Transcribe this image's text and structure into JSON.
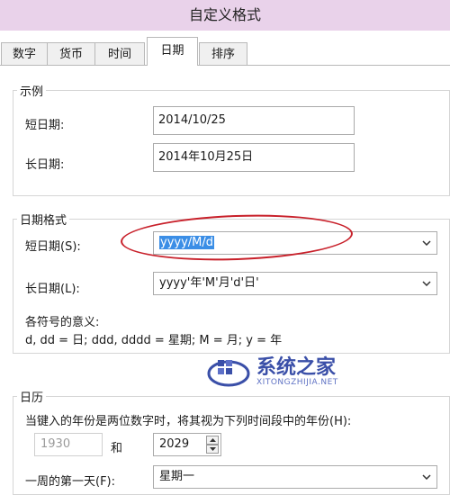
{
  "window": {
    "title": "自定义格式"
  },
  "tabs": [
    "数字",
    "货币",
    "时间",
    "日期",
    "排序"
  ],
  "example": {
    "title": "示例",
    "short_label": "短日期:",
    "short_value": "2014/10/25",
    "long_label": "长日期:",
    "long_value": "2014年10月25日"
  },
  "format": {
    "title": "日期格式",
    "short_label": "短日期(S):",
    "short_value": "yyyy/M/d",
    "long_label": "长日期(L):",
    "long_value": "yyyy'年'M'月'd'日'",
    "meaning_title": "各符号的意义:",
    "meaning_text": "d, dd = 日;  ddd, dddd = 星期;  M = 月;  y = 年"
  },
  "calendar": {
    "title": "日历",
    "two_digit_text": "当键入的年份是两位数字时，将其视为下列时间段中的年份(H):",
    "from_year": "1930",
    "and_label": "和",
    "to_year": "2029",
    "first_day_label": "一周的第一天(F):",
    "first_day_value": "星期一"
  },
  "watermark": {
    "text": "系统之家",
    "url": "XITONGZHIJIA.NET"
  },
  "colors": {
    "titlebar": "#e9d2ea",
    "selection": "#3b8ee6",
    "annotation": "#c8202a",
    "watermark": "#3a4fa8"
  }
}
